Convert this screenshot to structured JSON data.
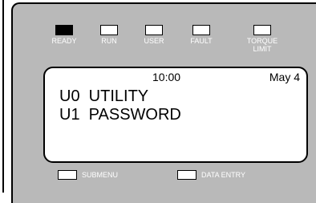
{
  "indicators": [
    {
      "label": "READY",
      "active": true
    },
    {
      "label": "RUN",
      "active": false
    },
    {
      "label": "USER",
      "active": false
    },
    {
      "label": "FAULT",
      "active": false
    },
    {
      "label": "TORQUE\nLIMIT",
      "active": false
    }
  ],
  "display": {
    "time": "10:00",
    "date": "May 4",
    "menu_lines": [
      "U0  UTILITY",
      "U1  PASSWORD"
    ]
  },
  "softkeys": {
    "submenu_label": "SUBMENU",
    "data_entry_label": "DATA ENTRY"
  },
  "colors": {
    "panel": "#b9b9b9",
    "label_text": "#ffffff",
    "led_on": "#000000",
    "led_off": "#ffffff"
  }
}
